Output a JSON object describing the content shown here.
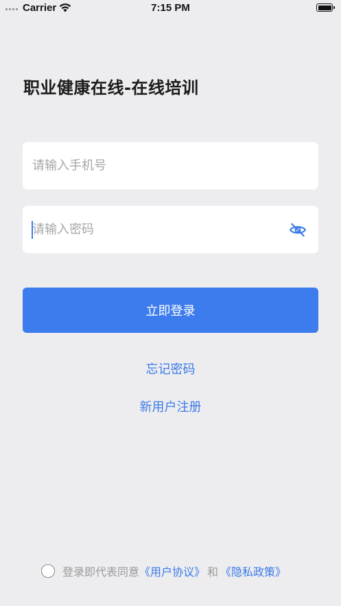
{
  "status_bar": {
    "carrier": "Carrier",
    "time": "7:15 PM"
  },
  "login": {
    "title": "职业健康在线-在线培训",
    "phone_placeholder": "请输入手机号",
    "password_placeholder": "请输入密码",
    "login_button": "立即登录",
    "forgot_password": "忘记密码",
    "register": "新用户注册"
  },
  "agreement": {
    "prefix": "登录即代表同意",
    "user_agreement": "《用户协议》",
    "and": "和",
    "privacy_policy": "《隐私政策》",
    "checked": false
  },
  "icons": {
    "wifi": "wifi-icon",
    "battery": "battery-icon",
    "password_visibility": "eye-off-icon"
  },
  "colors": {
    "background": "#ededf0",
    "accent": "#3d7ced",
    "link": "#3b7ae6",
    "placeholder": "#a6a6a6"
  }
}
